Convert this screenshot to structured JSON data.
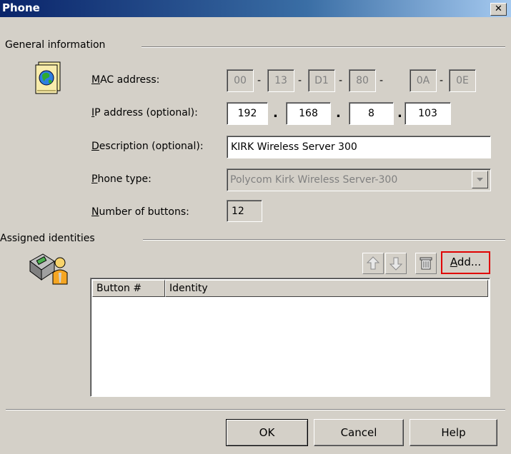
{
  "window": {
    "title": "Phone",
    "close_glyph": "✕"
  },
  "general": {
    "label": "General information",
    "icon": "globe-book-icon",
    "mac": {
      "label_pre": "",
      "label_u": "M",
      "label_post": "AC address:",
      "octets": [
        "00",
        "13",
        "D1",
        "80",
        "0A",
        "0E"
      ]
    },
    "ip": {
      "label_u": "I",
      "label_post": "P address (optional):",
      "octets": [
        "192",
        "168",
        "8",
        "103"
      ]
    },
    "description": {
      "label_u": "D",
      "label_post": "escription (optional):",
      "value": "KIRK Wireless Server 300"
    },
    "phone_type": {
      "label_u": "P",
      "label_post": "hone type:",
      "value": "Polycom Kirk Wireless Server-300"
    },
    "buttons": {
      "label_u": "N",
      "label_post": "umber of buttons:",
      "value": "12"
    }
  },
  "identities": {
    "label": "Assigned identities",
    "icon": "phone-user-icon",
    "toolbar": {
      "up": "arrow-up-icon",
      "down": "arrow-down-icon",
      "delete": "trash-icon",
      "add_u": "A",
      "add_post": "dd..."
    },
    "columns": [
      "Button #",
      "Identity"
    ],
    "rows": []
  },
  "footer": {
    "ok": "OK",
    "cancel": "Cancel",
    "help": "Help"
  }
}
